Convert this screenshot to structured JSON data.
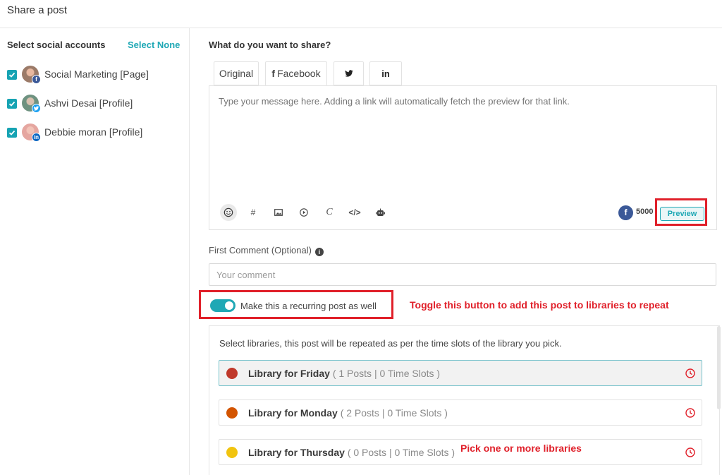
{
  "header": {
    "title": "Share a post"
  },
  "sidebar": {
    "title": "Select social accounts",
    "select_none": "Select None",
    "accounts": [
      {
        "label": "Social Marketing [Page]",
        "checked": true,
        "network": "facebook",
        "badge": "f"
      },
      {
        "label": "Ashvi Desai [Profile]",
        "checked": true,
        "network": "twitter",
        "badge": "t"
      },
      {
        "label": "Debbie moran [Profile]",
        "checked": true,
        "network": "linkedin",
        "badge": "in"
      }
    ]
  },
  "main": {
    "question": "What do you want to share?",
    "tabs": [
      {
        "label": "Original"
      },
      {
        "label": "Facebook",
        "icon": "f",
        "active": true
      },
      {
        "label": "",
        "icon": "twitter-icon"
      },
      {
        "label": "",
        "icon": "linkedin-icon",
        "glyph": "in"
      }
    ],
    "composer": {
      "placeholder": "Type your message here. Adding a link will automatically fetch the preview for that link.",
      "tools": [
        "emoji-icon",
        "hashtag-icon",
        "image-icon",
        "video-icon",
        "canva-icon",
        "embed-code-icon",
        "ai-bot-icon"
      ],
      "char_limit": "5000",
      "preview_label": "Preview"
    },
    "first_comment": {
      "label": "First Comment (Optional)",
      "info": "i",
      "placeholder": "Your comment"
    },
    "recurring": {
      "label": "Make this a recurring post as well",
      "enabled": true,
      "annotation": "Toggle this button to add this post to libraries to repeat"
    },
    "libraries": {
      "intro": "Select libraries, this post will be repeated as per the time slots of the library you pick.",
      "items": [
        {
          "name": "Library for Friday",
          "meta": "( 1 Posts | 0 Time Slots )",
          "color": "#c0392b",
          "selected": true
        },
        {
          "name": "Library for Monday",
          "meta": "( 2 Posts | 0 Time Slots )",
          "color": "#d35400",
          "selected": false
        },
        {
          "name": "Library for Thursday",
          "meta": "( 0 Posts | 0 Time Slots )",
          "color": "#f1c40f",
          "selected": false
        }
      ],
      "annotation": "Pick one or more libraries"
    }
  },
  "colors": {
    "accent": "#1fa8b5",
    "highlight": "#e0202a",
    "facebook": "#3b5998"
  }
}
